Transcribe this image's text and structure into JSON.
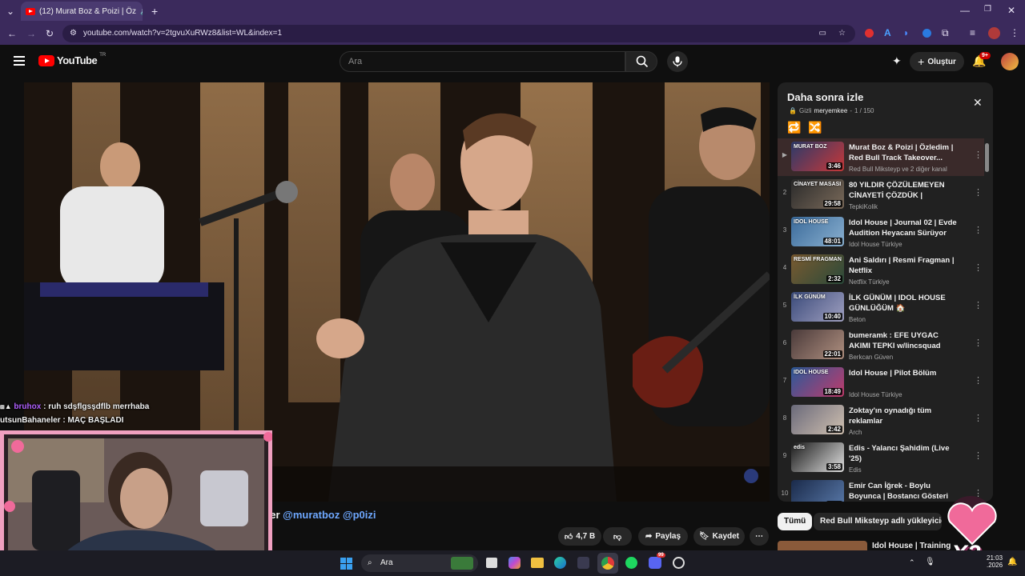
{
  "browser": {
    "tab_title": "(12) Murat Boz & Poizi | Öz",
    "url": "youtube.com/watch?v=2tgvuXuRWz8&list=WL&index=1"
  },
  "youtube": {
    "logo_text": "YouTube",
    "region": "TR",
    "search_placeholder": "Ara",
    "create_label": "Oluştur",
    "notification_count": "9+"
  },
  "playlist": {
    "title": "Daha sonra izle",
    "privacy": "Gizli",
    "owner": "meryemkee",
    "position": "1 / 150",
    "items": [
      {
        "num": "▶",
        "title": "Murat Boz & Poizi | Özledim | Red Bull Track Takeover...",
        "channel": "Red Bull Miksteyp ve 2 diğer kanal",
        "duration": "3:46",
        "color": "#2b3a6a",
        "color2": "#c83838",
        "thumb_text": "MURAT BOZ"
      },
      {
        "num": "2",
        "title": "80 YILDIR ÇÖZÜLEMEYEN CİNAYETİ ÇÖZDÜK | CİNAYET...",
        "channel": "TepkiKolik",
        "duration": "29:58",
        "color": "#2a2a2a",
        "color2": "#7a6a5a",
        "thumb_text": "CİNAYET MASASI"
      },
      {
        "num": "3",
        "title": "Idol House | Journal 02 | Evde Audition Heyacanı Sürüyor",
        "channel": "Idol House Türkiye",
        "duration": "48:01",
        "color": "#3a6a9a",
        "color2": "#8ab0d0",
        "thumb_text": "IDOL HOUSE"
      },
      {
        "num": "4",
        "title": "Ani Saldırı | Resmi Fragman | Netflix",
        "channel": "Netflix Türkiye",
        "duration": "2:32",
        "color": "#7a5a30",
        "color2": "#2a4a3a",
        "thumb_text": "RESMİ FRAGMAN"
      },
      {
        "num": "5",
        "title": "İLK GÜNÜM | IDOL HOUSE GÜNLÜĞÜM 🏠",
        "channel": "Beton",
        "duration": "10:40",
        "color": "#3a4a7a",
        "color2": "#a0a0c0",
        "thumb_text": "İLK GÜNÜM"
      },
      {
        "num": "6",
        "title": "bumeramk : EFE UYGAC AKIMI TEPKI w/lincsquad",
        "channel": "Berkcan Güven",
        "duration": "22:01",
        "color": "#4a3a3a",
        "color2": "#b09080",
        "thumb_text": ""
      },
      {
        "num": "7",
        "title": "Idol House | Pilot Bölüm",
        "channel": "Idol House Türkiye",
        "duration": "18:49",
        "color": "#2a5a9a",
        "color2": "#c03a6a",
        "thumb_text": "IDOL HOUSE"
      },
      {
        "num": "8",
        "title": "Zoktay'ın oynadığı tüm reklamlar",
        "channel": "Arch",
        "duration": "2:42",
        "color": "#6a6a7a",
        "color2": "#d0c0b0",
        "thumb_text": ""
      },
      {
        "num": "9",
        "title": "Edis - Yalancı Şahidim (Live '25)",
        "channel": "Edis",
        "duration": "3:58",
        "color": "#1a1a1a",
        "color2": "#e0e0e0",
        "thumb_text": "edis"
      },
      {
        "num": "10",
        "title": "Emir Can İğrek - Boylu Boyunca | Bostancı Gösteri Merkezi...",
        "channel": "",
        "duration": "3:51",
        "color": "#1a2a4a",
        "color2": "#5a7aaa",
        "thumb_text": ""
      }
    ]
  },
  "video_meta": {
    "title_fragment": "ver",
    "mentions": "@muratboz @p0izi",
    "likes": "4,7 B",
    "share_label": "Paylaş",
    "save_label": "Kaydet"
  },
  "chips": {
    "all": "Tümü",
    "uploader": "Red Bull Miksteyp adlı yükleyiciden"
  },
  "next_up": {
    "title": "Idol House | Training"
  },
  "chat": [
    {
      "user": "bruhox",
      "message": ": ruh sdşflgsşdflb merrhaba"
    },
    {
      "user": "utsunBahaneler",
      "message": ": MAÇ BAŞLADI"
    }
  ],
  "overlay_badge": "X3",
  "taskbar": {
    "search_label": "Ara",
    "time": "21:03",
    "date": ".2026",
    "discord_badge": "99"
  }
}
